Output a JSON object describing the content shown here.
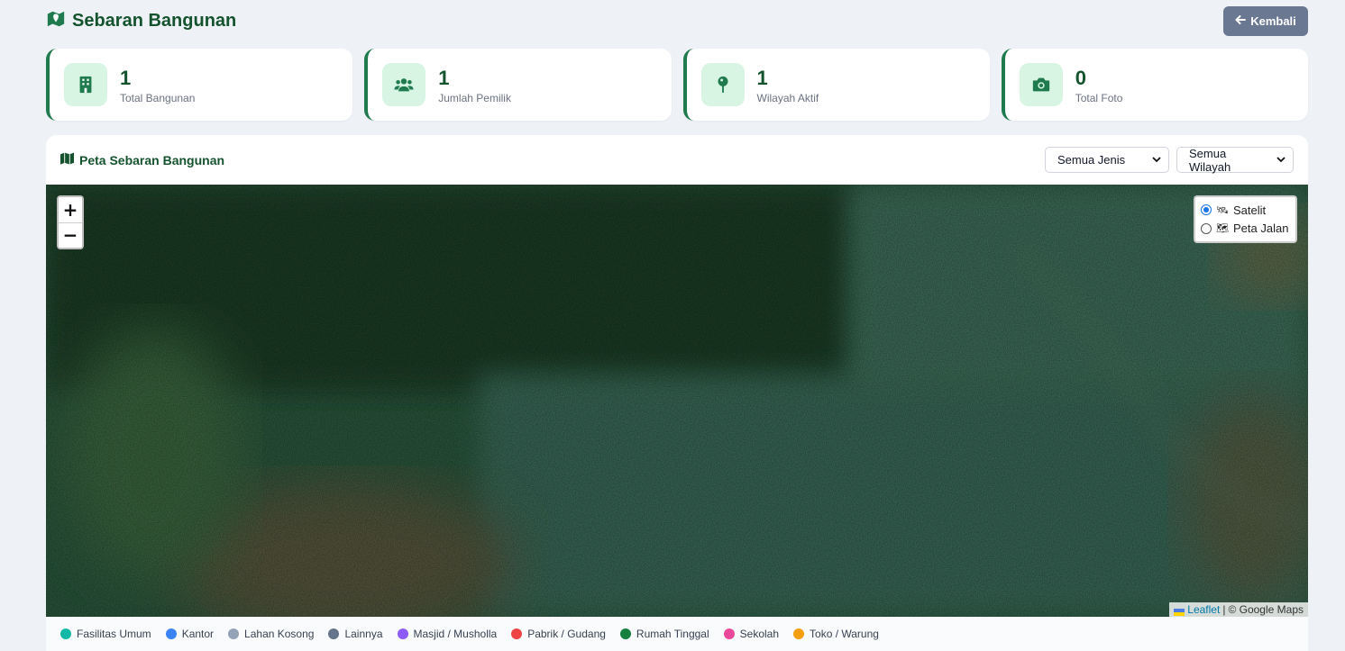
{
  "header": {
    "title": "Sebaran Bangunan",
    "back_label": "Kembali"
  },
  "stats": [
    {
      "value": "1",
      "label": "Total Bangunan",
      "icon": "building-icon"
    },
    {
      "value": "1",
      "label": "Jumlah Pemilik",
      "icon": "users-icon"
    },
    {
      "value": "1",
      "label": "Wilayah Aktif",
      "icon": "map-pin-icon"
    },
    {
      "value": "0",
      "label": "Total Foto",
      "icon": "camera-icon"
    }
  ],
  "map_panel": {
    "title": "Peta Sebaran Bangunan",
    "filter_type": "Semua Jenis",
    "filter_region": "Semua Wilayah",
    "layers": [
      {
        "label": "Satelit",
        "selected": true
      },
      {
        "label": "Peta Jalan",
        "selected": false
      }
    ],
    "attribution_leaflet": "Leaflet",
    "attribution_sep": "|",
    "attribution_source": "© Google Maps"
  },
  "legend": [
    {
      "label": "Fasilitas Umum",
      "color": "#14b8a6"
    },
    {
      "label": "Kantor",
      "color": "#3b82f6"
    },
    {
      "label": "Lahan Kosong",
      "color": "#94a3b8"
    },
    {
      "label": "Lainnya",
      "color": "#64748b"
    },
    {
      "label": "Masjid / Musholla",
      "color": "#8b5cf6"
    },
    {
      "label": "Pabrik / Gudang",
      "color": "#ef4444"
    },
    {
      "label": "Rumah Tinggal",
      "color": "#15803d"
    },
    {
      "label": "Sekolah",
      "color": "#ec4899"
    },
    {
      "label": "Toko / Warung",
      "color": "#f59e0b"
    }
  ],
  "colors": {
    "brand": "#14532d",
    "accent": "#1f7a4d",
    "icon_bg": "#d8f5e3",
    "back_button": "#6b7891"
  }
}
